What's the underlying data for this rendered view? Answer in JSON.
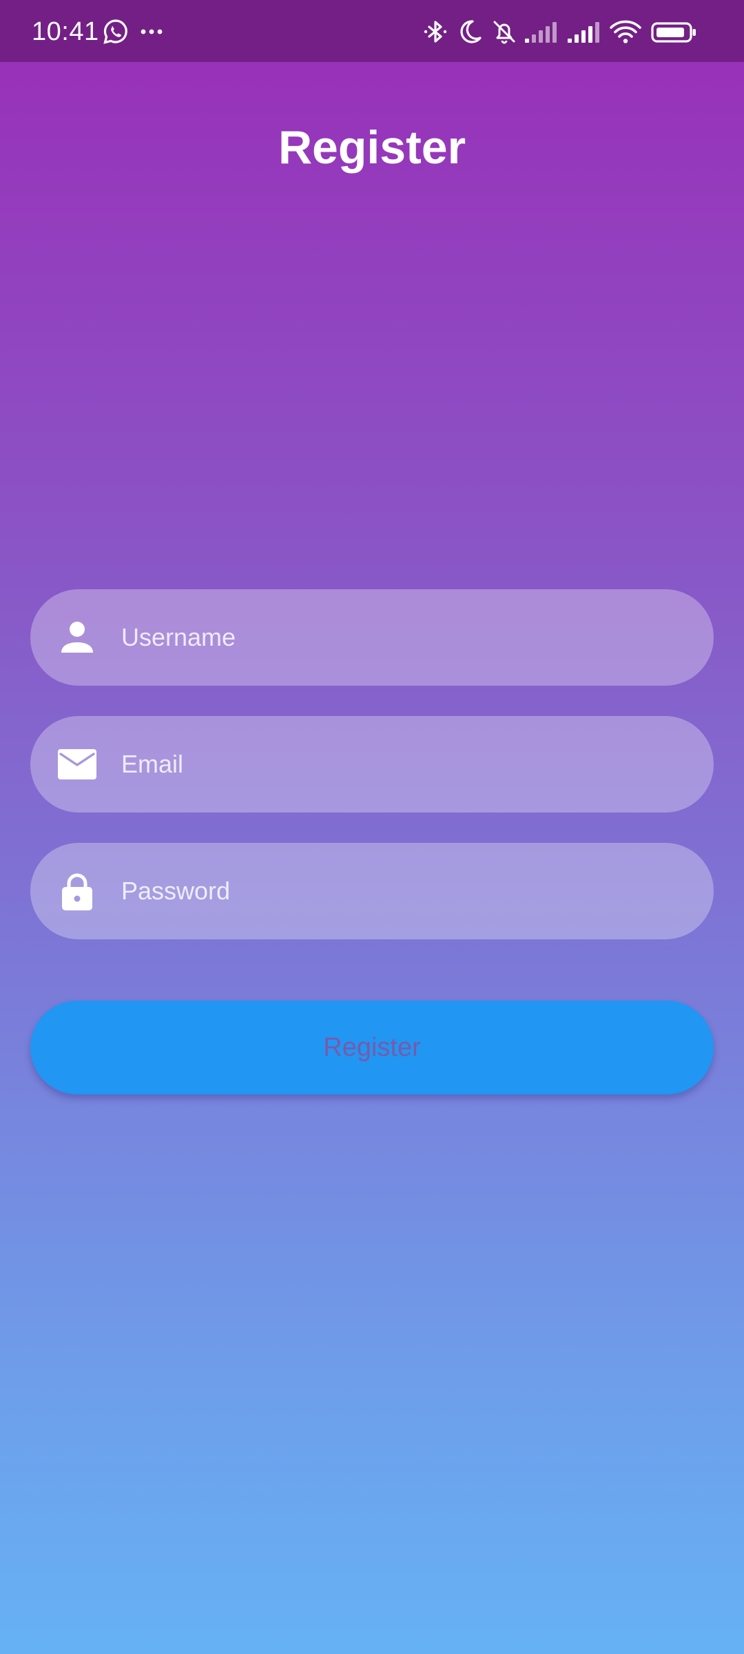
{
  "status_bar": {
    "time": "10:41",
    "left_icons": [
      "whatsapp-icon",
      "more-dots-icon"
    ],
    "right_icons": [
      "bluetooth-icon",
      "moon-icon",
      "bell-off-icon",
      "signal-icon",
      "signal-icon",
      "wifi-icon",
      "battery-icon"
    ]
  },
  "page": {
    "title": "Register"
  },
  "form": {
    "username": {
      "placeholder": "Username",
      "value": "",
      "icon": "person-icon"
    },
    "email": {
      "placeholder": "Email",
      "value": "",
      "icon": "mail-icon"
    },
    "password": {
      "placeholder": "Password",
      "value": "",
      "icon": "lock-icon"
    }
  },
  "actions": {
    "register_label": "Register"
  },
  "colors": {
    "status_bar": "#741F86",
    "gradient_top": "#9A2DB7",
    "gradient_bottom": "#66B1F4",
    "button": "#2196F3",
    "button_text": "#7A5AA8"
  }
}
